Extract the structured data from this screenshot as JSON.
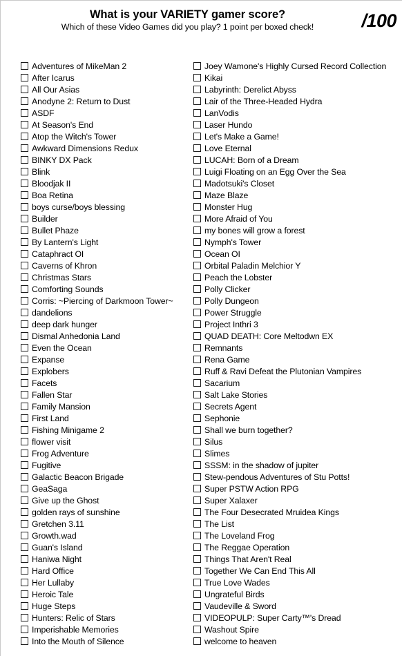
{
  "header": {
    "title": "What is your VARIETY gamer score?",
    "subtitle": "Which of these Video Games did you play? 1 point per boxed check!",
    "score_field": "/100"
  },
  "columns": {
    "left": [
      "Adventures of MikeMan 2",
      "After Icarus",
      "All Our Asias",
      "Anodyne 2: Return to Dust",
      "ASDF",
      "At Season's End",
      "Atop the Witch's Tower",
      "Awkward Dimensions Redux",
      "BINKY DX Pack",
      "Blink",
      "Bloodjak II",
      "Boa Retina",
      "boys curse/boys blessing",
      "Builder",
      "Bullet Phaze",
      "By Lantern's Light",
      "Cataphract OI",
      "Caverns of Khron",
      "Christmas Stars",
      "Comforting Sounds",
      "Corris: ~Piercing of Darkmoon Tower~",
      "dandelions",
      "deep dark hunger",
      "Dismal Anhedonia Land",
      "Even the Ocean",
      "Expanse",
      "Explobers",
      "Facets",
      "Fallen Star",
      "Family Mansion",
      "First Land",
      "Fishing Minigame 2",
      "flower visit",
      "Frog Adventure",
      "Fugitive",
      "Galactic Beacon Brigade",
      "GeaSaga",
      "Give up the Ghost",
      "golden rays of sunshine",
      "Gretchen 3.11",
      "Growth.wad",
      "Guan's Island",
      "Haniwa Night",
      "Hard Office",
      "Her Lullaby",
      "Heroic Tale",
      "Huge Steps",
      "Hunters: Relic of Stars",
      "Imperishable Memories",
      "Into the Mouth of Silence"
    ],
    "right": [
      "Joey Wamone's Highly Cursed Record Collection",
      "Kikai",
      "Labyrinth: Derelict Abyss",
      "Lair of the Three-Headed Hydra",
      "LanVodis",
      "Laser Hundo",
      "Let's Make a Game!",
      "Love Eternal",
      "LUCAH: Born of a Dream",
      "Luigi Floating on an Egg Over the Sea",
      "Madotsuki's Closet",
      "Maze Blaze",
      "Monster Hug",
      "More Afraid of You",
      "my bones will grow a forest",
      "Nymph's Tower",
      "Ocean OI",
      "Orbital Paladin Melchior Y",
      "Peach the Lobster",
      "Polly Clicker",
      "Polly Dungeon",
      "Power Struggle",
      "Project Inthri 3",
      "QUAD DEATH: Core Meltodwn EX",
      "Remnants",
      "Rena Game",
      "Ruff & Ravi Defeat the Plutonian Vampires",
      "Sacarium",
      "Salt Lake Stories",
      "Secrets Agent",
      "Sephonie",
      "Shall we burn together?",
      "Silus",
      "Slimes",
      "SSSM: in the shadow of jupiter",
      "Stew-pendous Adventures of Stu Potts!",
      "Super PSTW Action RPG",
      "Super Xalaxer",
      "The Four Desecrated Mruidea Kings",
      "The List",
      "The Loveland Frog",
      "The Reggae Operation",
      "Things That Aren't Real",
      "Together We Can End This All",
      "True Love Wades",
      "Ungrateful Birds",
      "Vaudeville & Sword",
      "VIDEOPULP: Super Carty™'s Dread",
      "Washout Spire",
      "welcome to heaven"
    ]
  }
}
